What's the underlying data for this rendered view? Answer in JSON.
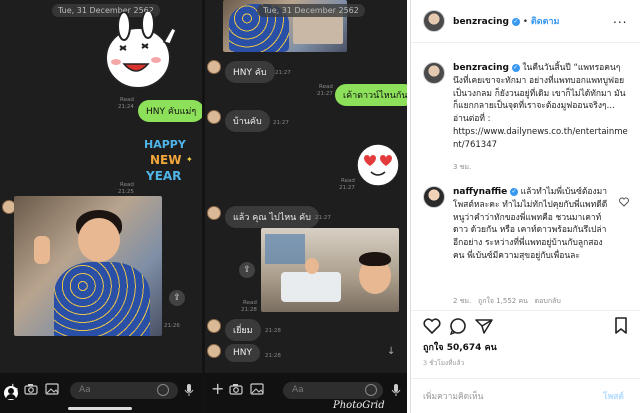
{
  "chat_left": {
    "date_chip": "Tue, 31 December 2562",
    "read_label": "Read",
    "msg1": {
      "text": "HNY คับแม่ๆ",
      "time": "21:24"
    },
    "sticker1_time": "21:25",
    "photo_time": "21:26",
    "input_placeholder": "Aa"
  },
  "chat_right": {
    "date_chip": "Tue, 31 December 2562",
    "read_label": "Read",
    "messages": [
      {
        "text": "HNY คับ",
        "time": "21:27"
      },
      {
        "text": "เค้าดาวน์ไหนกัน",
        "time": "21:27"
      },
      {
        "text": "บ้านคับ",
        "time": "21:27"
      },
      {
        "text": "แล้ว คุณ ไปไหน คับ",
        "time": "21:27"
      },
      {
        "text": "เยี่ยม",
        "time": "21:28"
      },
      {
        "text": "HNY",
        "time": "21:28"
      }
    ],
    "sticker_time": "21:27",
    "photo_time": "21:28",
    "input_placeholder": "Aa",
    "watermark": "PhotoGrid"
  },
  "instagram": {
    "header": {
      "username": "benzracing",
      "follow_label": "ติดตาม",
      "more": "..."
    },
    "caption": {
      "username": "benzracing",
      "text": "ในคืนวันสิ้นปี “แพทรอคนๆนึงที่เคยเขาจะทักมา อย่างที่แพทบอกแพทบูฟอยเป็นวงกลม ก็ยังวนอยู่ที่เดิม เขาก็ไม่ได้ทักมา มันก็แยกกลายเป็นจุดที่เราจะต้องมูฟออนจริงๆ… อ่านต่อที่ :",
      "link": "https://www.dailynews.co.th/entertainment/761347",
      "age": "3 ชม."
    },
    "comment": {
      "username": "naffynaffie",
      "text": "แล้วทำไมพี่เบ้นซ์ต้องมาโพสต์หละคะ ทำไมไม่ทักไปคุยกับพี่แพทดีดี หนูว่าคำว่าทักของพี่แพทคือ ชวนมาเคาท์ดาว ด้วยกัน หรือ เคาท์ดาวพร้อมกันรึเปล่า อีกอย่าง ระหว่างที่พี่แพทอยู่บ้านกับลูกสองคน พี่เบ้นซ์มีความสุขอยู่กับเพื่อนละ",
      "age": "2 ชม.",
      "likes": "ถูกใจ 1,552 คน",
      "reply": "ตอบกลับ"
    },
    "likes_total": "ถูกใจ 50,674 คน",
    "timestamp": "3 ชั่วโมงที่แล้ว",
    "add_comment_placeholder": "เพิ่มความคิดเห็น",
    "post_label": "โพสต์"
  },
  "colors": {
    "line_green": "#8de05a",
    "ig_blue": "#3897f0",
    "chat_bg": "#1e1e1e"
  }
}
